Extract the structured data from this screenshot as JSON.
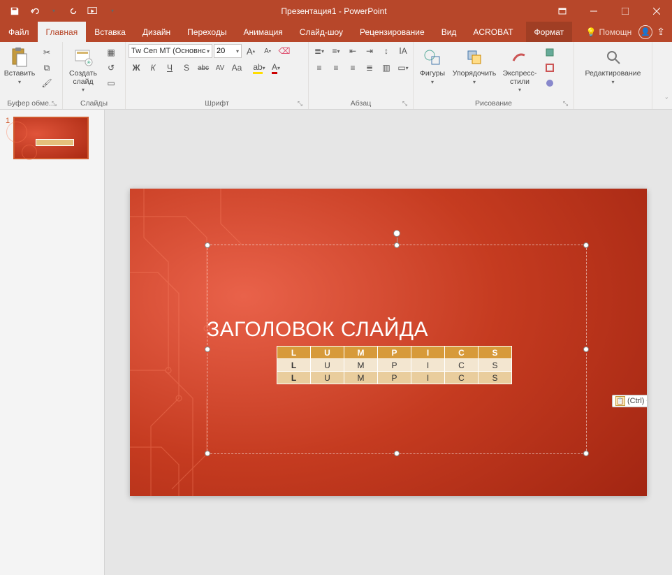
{
  "title": "Презентация1 - PowerPoint",
  "qat": {
    "save": "💾",
    "undo": "↶",
    "redo": "↻",
    "fromstart": "▢",
    "more": "▾"
  },
  "tabs": {
    "file": "Файл",
    "home": "Главная",
    "insert": "Вставка",
    "design": "Дизайн",
    "transitions": "Переходы",
    "animation": "Анимация",
    "slideshow": "Слайд-шоу",
    "review": "Рецензирование",
    "view": "Вид",
    "acrobat": "ACROBAT",
    "format": "Формат"
  },
  "tellme": "Помощн",
  "groups": {
    "clipboard": {
      "label": "Буфер обме...",
      "paste": "Вставить"
    },
    "slides": {
      "label": "Слайды",
      "newslide": "Создать слайд"
    },
    "font": {
      "label": "Шрифт",
      "name": "Tw Cen MT (Основнс",
      "size": "20",
      "bold": "Ж",
      "italic": "К",
      "underline": "Ч",
      "shadow": "S",
      "strike": "abc",
      "charspace": "AV",
      "case": "Aa",
      "grow": "A",
      "shrink": "A",
      "clear": "✎"
    },
    "paragraph": {
      "label": "Абзац"
    },
    "drawing": {
      "label": "Рисование",
      "shapes": "Фигуры",
      "arrange": "Упорядочить",
      "quickstyles": "Экспресс-стили"
    },
    "editing": {
      "label": "Редактирование"
    }
  },
  "slide": {
    "number": "1",
    "title": "ЗАГОЛОВОК СЛАЙДА",
    "table": {
      "headers": [
        "L",
        "U",
        "M",
        "P",
        "I",
        "C",
        "S"
      ],
      "rows": [
        [
          "L",
          "U",
          "M",
          "P",
          "I",
          "C",
          "S"
        ],
        [
          "L",
          "U",
          "M",
          "P",
          "I",
          "C",
          "S"
        ]
      ]
    },
    "paste_tag": "(Ctrl)"
  }
}
